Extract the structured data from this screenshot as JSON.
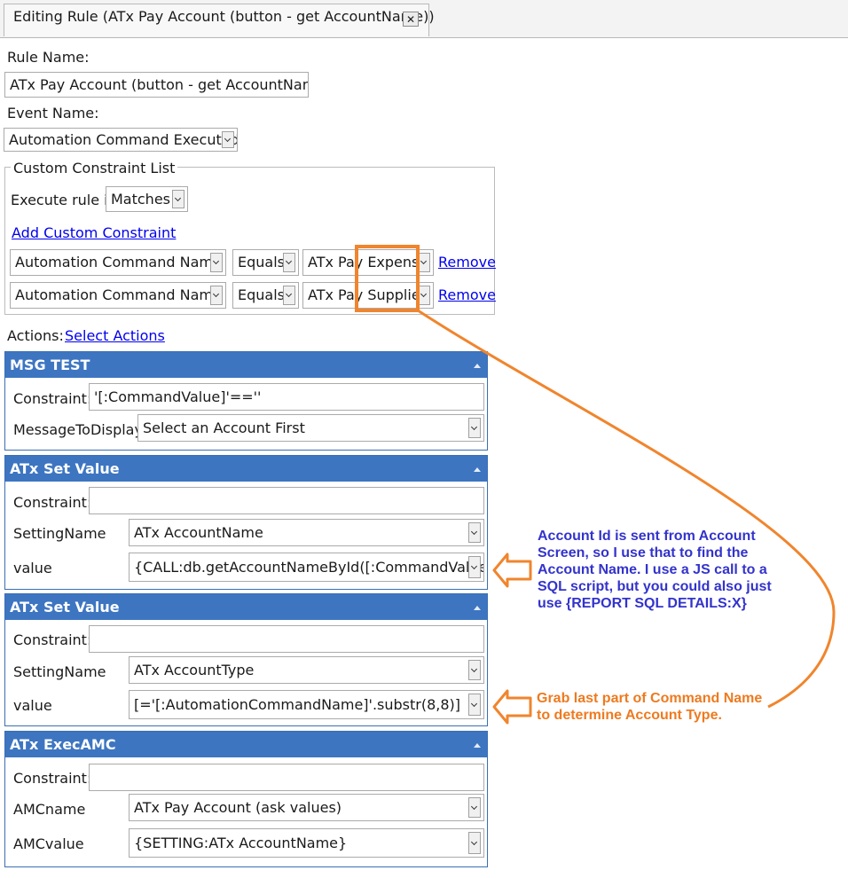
{
  "tab": {
    "title": "Editing Rule (ATx Pay Account (button - get AccountName))",
    "close_icon": "close-icon"
  },
  "rule": {
    "name_label": "Rule Name:",
    "name_value": "ATx Pay Account (button - get AccountName)",
    "event_label": "Event Name:",
    "event_value": "Automation Command Executed"
  },
  "constraints": {
    "legend": "Custom Constraint List",
    "execute_label": "Execute rule if",
    "execute_value": "Matches",
    "add_link": "Add Custom Constraint",
    "rows": [
      {
        "field": "Automation Command Name",
        "operator": "Equals",
        "value": "ATx Pay Expense",
        "remove": "Remove"
      },
      {
        "field": "Automation Command Name",
        "operator": "Equals",
        "value": "ATx Pay Supplier",
        "remove": "Remove"
      }
    ]
  },
  "actions": {
    "label": "Actions:",
    "select_link": "Select Actions",
    "panels": [
      {
        "title": "MSG TEST",
        "fields": [
          {
            "label": "Constraint:",
            "value": "'[:CommandValue]'==''"
          },
          {
            "label": "MessageToDisplay",
            "value": "Select an Account First"
          }
        ]
      },
      {
        "title": "ATx Set Value",
        "fields": [
          {
            "label": "Constraint:",
            "value": ""
          },
          {
            "label": "SettingName",
            "value": "ATx AccountName"
          },
          {
            "label": "value",
            "value": "{CALL:db.getAccountNameById([:CommandValue])}"
          }
        ]
      },
      {
        "title": "ATx Set Value",
        "fields": [
          {
            "label": "Constraint:",
            "value": ""
          },
          {
            "label": "SettingName",
            "value": "ATx AccountType"
          },
          {
            "label": "value",
            "value": "[='[:AutomationCommandName]'.substr(8,8)]"
          }
        ]
      },
      {
        "title": "ATx ExecAMC",
        "fields": [
          {
            "label": "Constraint:",
            "value": ""
          },
          {
            "label": "AMCname",
            "value": "ATx Pay Account (ask values)"
          },
          {
            "label": "AMCvalue",
            "value": "{SETTING:ATx AccountName}"
          }
        ]
      }
    ]
  },
  "annotations": {
    "note1": [
      "Account Id is sent from Account",
      "Screen, so I use that to find the",
      "Account Name.  I use a JS call to a",
      "SQL script, but you could also just",
      "use {REPORT SQL DETAILS:X}"
    ],
    "note2": [
      "Grab last part of Command Name",
      "to determine Account Type."
    ],
    "colors": {
      "blue": "#3333cc",
      "orange": "#ee7a1f",
      "header": "#3d75c1"
    }
  }
}
